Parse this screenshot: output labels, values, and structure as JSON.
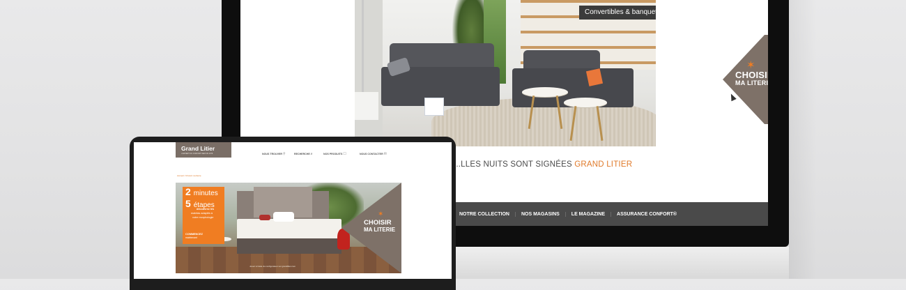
{
  "imac": {
    "hero_tag": "Convertibles & banquettes",
    "choisir": {
      "line1": "CHOISIR",
      "line2": "MA LITERIE",
      "star": "✶"
    },
    "tagline_prefix": "...LLES NUITS SONT SIGNÉES",
    "tagline_brand": "GRAND LITIER",
    "nav": [
      "NOTRE COLLECTION",
      "NOS MAGASINS",
      "LE MAGAZINE",
      "ASSURANCE CONFORT®"
    ],
    "apple_logo": ""
  },
  "laptop": {
    "logo": {
      "name": "Grand Litier",
      "tagline": "L'EXPERT DU CONFORT DEPUIS 1978"
    },
    "nav": [
      {
        "label": "NOUS TROUVER",
        "icon": "⚲"
      },
      {
        "label": "RECHERCHE",
        "icon": "⌕"
      },
      {
        "label": "NOS PRODUITS",
        "icon": "☐"
      },
      {
        "label": "NOUS CONTACTER",
        "icon": "✉"
      }
    ],
    "breadcrumb": "Accueil / Choisir ma literie",
    "promo": {
      "n1": "2",
      "w1": "minutes",
      "n2": "5",
      "w2": "étapes",
      "d1": "découvrez les",
      "d2": "matelas adaptés à",
      "d3": "votre morphologie",
      "cta": "COMMENCEZ",
      "cta2": "maintenant"
    },
    "banner_footer": "Jouez à l'aide du configurateur sur grandlitier.com",
    "choisir": {
      "line1": "CHOISIR",
      "line2": "MA LITERIE",
      "star": "✶"
    }
  },
  "colors": {
    "accent": "#f07d22",
    "taupe": "#7e7168",
    "nav_bg": "#4a4a4a"
  }
}
